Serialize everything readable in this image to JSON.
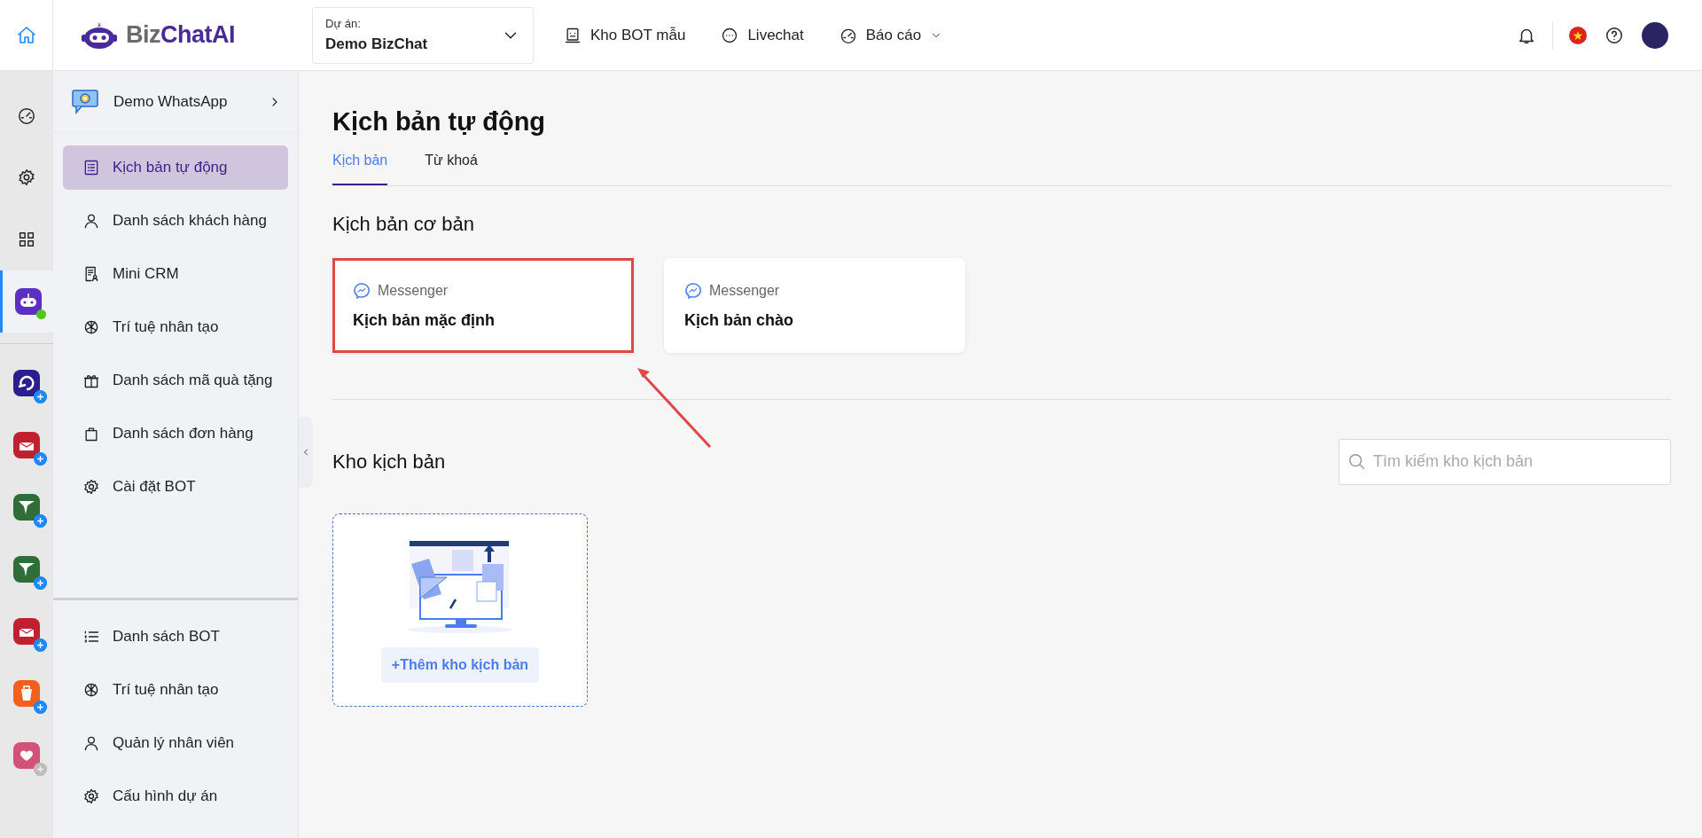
{
  "topbar": {
    "logo": {
      "prefix": "Biz",
      "name": "ChatAI"
    },
    "project": {
      "label": "Dự án:",
      "value": "Demo BizChat"
    },
    "nav": [
      {
        "label": "Kho BOT mẫu",
        "dropdown": false
      },
      {
        "label": "Livechat",
        "dropdown": false
      },
      {
        "label": "Báo cáo",
        "dropdown": true
      }
    ]
  },
  "rail": {
    "apps": [
      {
        "kind": "bot",
        "color": "#5a2fc2",
        "selected": true,
        "online": true
      },
      {
        "kind": "swirl",
        "color": "#2b1f8f",
        "selected": false,
        "online": false,
        "add_disabled": false
      },
      {
        "kind": "mail",
        "color": "#c0202f",
        "selected": false,
        "online": false,
        "add_disabled": false
      },
      {
        "kind": "plane",
        "color": "#2f6e38",
        "selected": false,
        "online": false,
        "add_disabled": false
      },
      {
        "kind": "plane",
        "color": "#2f6e38",
        "selected": false,
        "online": false,
        "add_disabled": false
      },
      {
        "kind": "mail",
        "color": "#c0202f",
        "selected": false,
        "online": false,
        "add_disabled": false
      },
      {
        "kind": "bag",
        "color": "#f2601c",
        "selected": false,
        "online": false,
        "add_disabled": false
      },
      {
        "kind": "heart",
        "color": "#d2527a",
        "selected": false,
        "online": false,
        "add_disabled": true
      }
    ]
  },
  "sidebar": {
    "header": {
      "title": "Demo WhatsApp"
    },
    "items": [
      {
        "label": "Kịch bản tự động",
        "selected": true
      },
      {
        "label": "Danh sách khách hàng",
        "selected": false
      },
      {
        "label": "Mini CRM",
        "selected": false
      },
      {
        "label": "Trí tuệ nhân tạo",
        "selected": false
      },
      {
        "label": "Danh sách mã quà tặng",
        "selected": false
      },
      {
        "label": "Danh sách đơn hàng",
        "selected": false
      },
      {
        "label": "Cài đặt BOT",
        "selected": false
      }
    ],
    "bottom_items": [
      {
        "label": "Danh sách BOT",
        "selected": false
      },
      {
        "label": "Trí tuệ nhân tạo",
        "selected": false
      },
      {
        "label": "Quản lý nhân viên",
        "selected": false
      },
      {
        "label": "Cấu hình dự án",
        "selected": false
      }
    ]
  },
  "main": {
    "title": "Kịch bản tự động",
    "tabs": [
      {
        "label": "Kịch bản",
        "selected": true
      },
      {
        "label": "Từ khoá",
        "selected": false
      }
    ],
    "basic": {
      "title": "Kịch bản cơ bản",
      "cards": [
        {
          "channel": "Messenger",
          "title": "Kịch bản mặc định",
          "highlighted": true
        },
        {
          "channel": "Messenger",
          "title": "Kịch bản chào",
          "highlighted": false
        }
      ]
    },
    "annotation_arrow": true,
    "library": {
      "title": "Kho kịch bản",
      "search": {
        "placeholder": "Tìm kiếm kho kịch bản"
      },
      "add_label": "+Thêm kho kịch bản"
    }
  }
}
